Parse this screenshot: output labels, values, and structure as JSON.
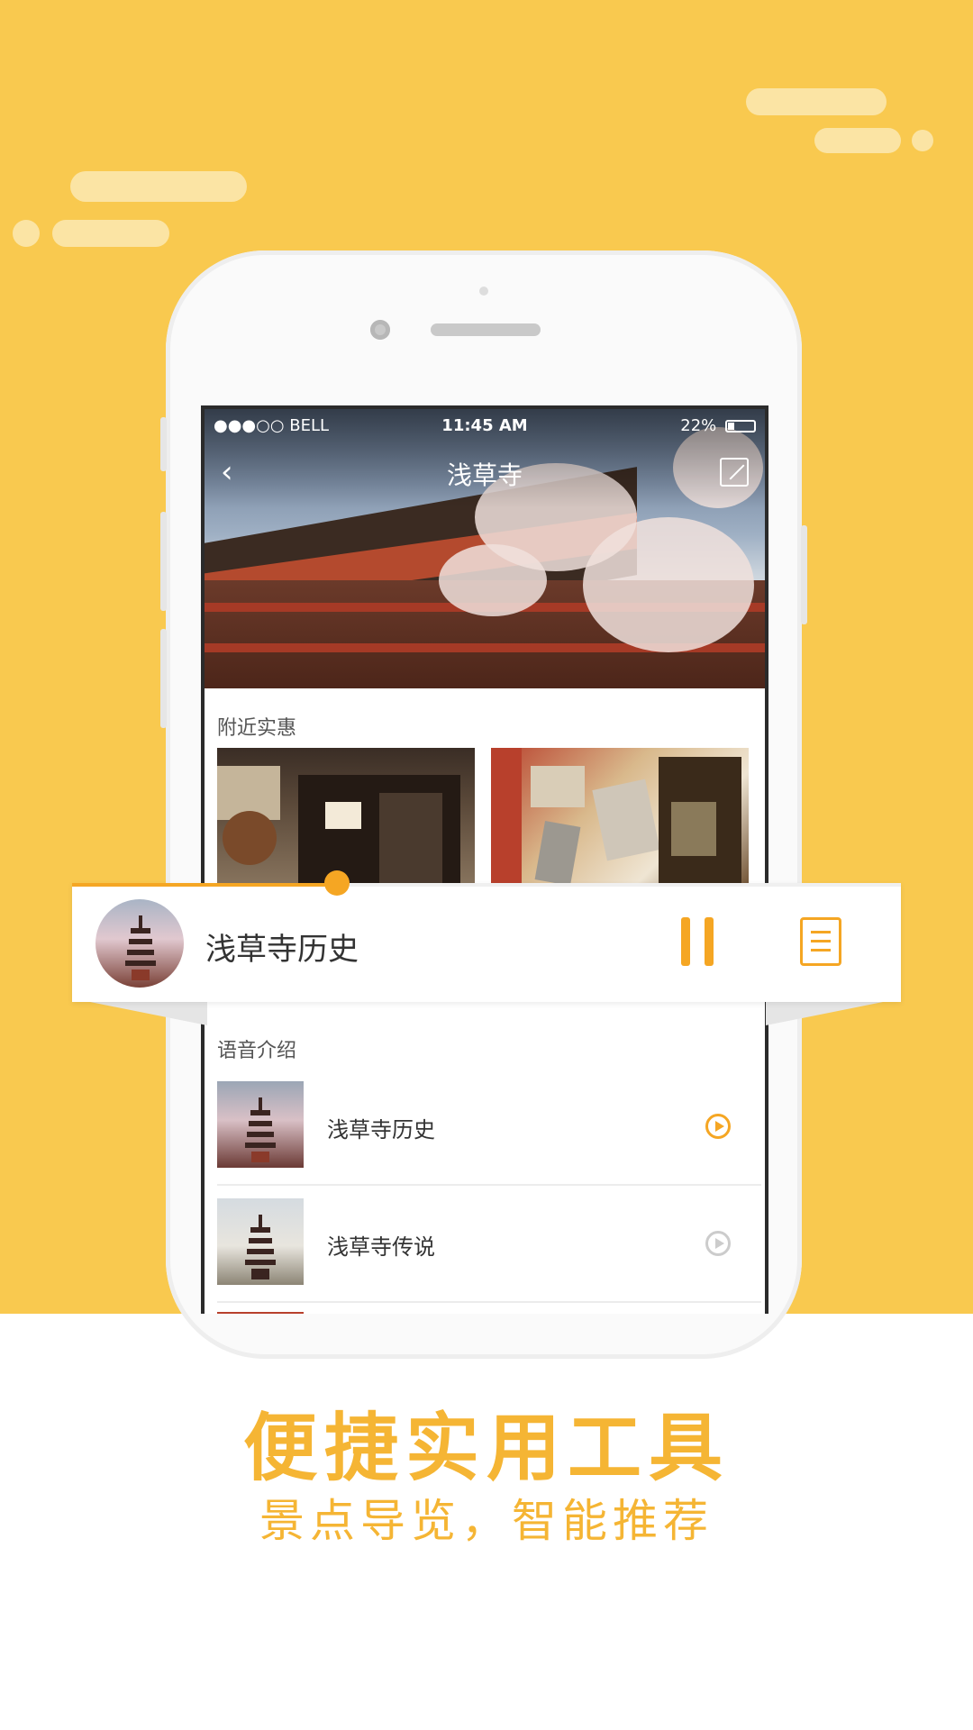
{
  "status_bar": {
    "carrier": "●●●○○ BELL",
    "time": "11:45 AM",
    "battery": "22%",
    "battery_level": 0.22
  },
  "navbar": {
    "title": "浅草寺"
  },
  "sections": {
    "deals_label": "附近实惠",
    "audio_label": "语音介绍"
  },
  "audio_items": [
    {
      "title": "浅草寺历史",
      "state": "active"
    },
    {
      "title": "浅草寺传说",
      "state": "inactive"
    }
  ],
  "player": {
    "title": "浅草寺历史",
    "progress": 0.32
  },
  "promo": {
    "headline": "便捷实用工具",
    "subline": "景点导览，智能推荐"
  },
  "colors": {
    "background": "#f9c94f",
    "accent": "#f5a623",
    "inactive": "#cccccc",
    "cloud": "#fbe4a4"
  },
  "icons": [
    "back-icon",
    "expand-icon",
    "wifi-icon",
    "bluetooth-icon",
    "battery-icon",
    "play-icon",
    "pause-icon",
    "document-icon"
  ]
}
